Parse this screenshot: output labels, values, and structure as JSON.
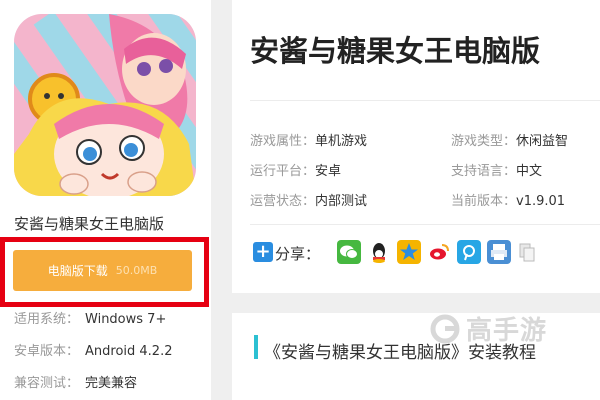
{
  "left": {
    "app_name": "安酱与糖果女王电脑版",
    "download_label": "电脑版下载",
    "download_size": "50.0MB",
    "specs": [
      {
        "key": "适用系统：",
        "value": "Windows 7+"
      },
      {
        "key": "安卓版本：",
        "value": "Android 4.2.2"
      },
      {
        "key": "兼容测试：",
        "value": "完美兼容"
      }
    ]
  },
  "main": {
    "title": "安酱与糖果女王电脑版",
    "info": [
      {
        "key": "游戏属性：",
        "value": "单机游戏"
      },
      {
        "key": "游戏类型：",
        "value": "休闲益智"
      },
      {
        "key": "运行平台：",
        "value": "安卓"
      },
      {
        "key": "支持语言：",
        "value": "中文"
      },
      {
        "key": "运营状态：",
        "value": "内部测试"
      },
      {
        "key": "当前版本：",
        "value": "v1.9.01"
      }
    ],
    "share_label": "分享：",
    "share_icons": [
      "wechat-icon",
      "qq-icon",
      "qzone-icon",
      "weibo-icon",
      "tencent-weibo-icon",
      "print-icon",
      "copy-icon"
    ]
  },
  "section": {
    "title": "《安酱与糖果女王电脑版》安装教程"
  },
  "watermark": {
    "text": "高手游"
  },
  "colors": {
    "download_button": "#f6ad3d",
    "highlight_frame": "#e60012",
    "section_accent": "#2cc0d2",
    "share_plus": "#2a8de0"
  }
}
